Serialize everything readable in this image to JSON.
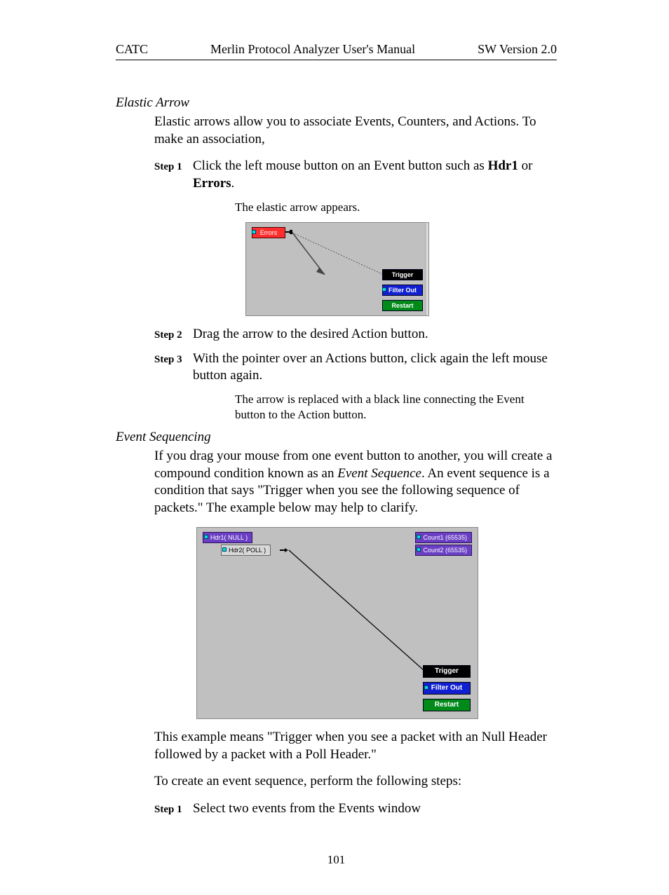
{
  "header": {
    "left": "CATC",
    "center": "Merlin Protocol Analyzer User's Manual",
    "right": "SW Version 2.0"
  },
  "sec1": {
    "title": "Elastic Arrow",
    "intro": "Elastic arrows allow you to associate Events, Counters, and Actions.  To make an association,",
    "step1_label": "Step 1",
    "step1_a": "Click the left mouse button on an Event button such as ",
    "step1_b": "Hdr1",
    "step1_c": " or ",
    "step1_d": "Errors",
    "step1_e": ".",
    "sub1": "The elastic arrow appears.",
    "step2_label": "Step 2",
    "step2": "Drag the arrow to the desired Action button.",
    "step3_label": "Step 3",
    "step3": "With the pointer over an Actions button, click again the left mouse button again.",
    "sub2": "The arrow is replaced with a black line connecting the Event button to the Action button."
  },
  "fig1": {
    "errors": "Errors",
    "trigger": "Trigger",
    "filter": "Filter Out",
    "restart": "Restart"
  },
  "sec2": {
    "title": "Event Sequencing",
    "p1a": " If you drag your mouse from one event button to another, you will create a compound condition known as an ",
    "p1b": "Event Sequence",
    "p1c": ".  An event sequence is a condition that says \"Trigger when you see the following sequence of packets.\"  The example below may help to clarify.",
    "p2": "This example means \"Trigger when you see a packet with an Null Header followed by a packet with a Poll Header.\"",
    "p3": "To create an event sequence, perform the following steps:",
    "step1_label": "Step 1",
    "step1": "Select two events from the Events window"
  },
  "fig2": {
    "hdr1": "Hdr1( NULL )",
    "hdr2": "Hdr2( POLL )",
    "count1": "Count1 (65535)",
    "count2": "Count2 (65535)",
    "trigger": "Trigger",
    "filter": "Filter Out",
    "restart": "Restart"
  },
  "pagenum": "101"
}
